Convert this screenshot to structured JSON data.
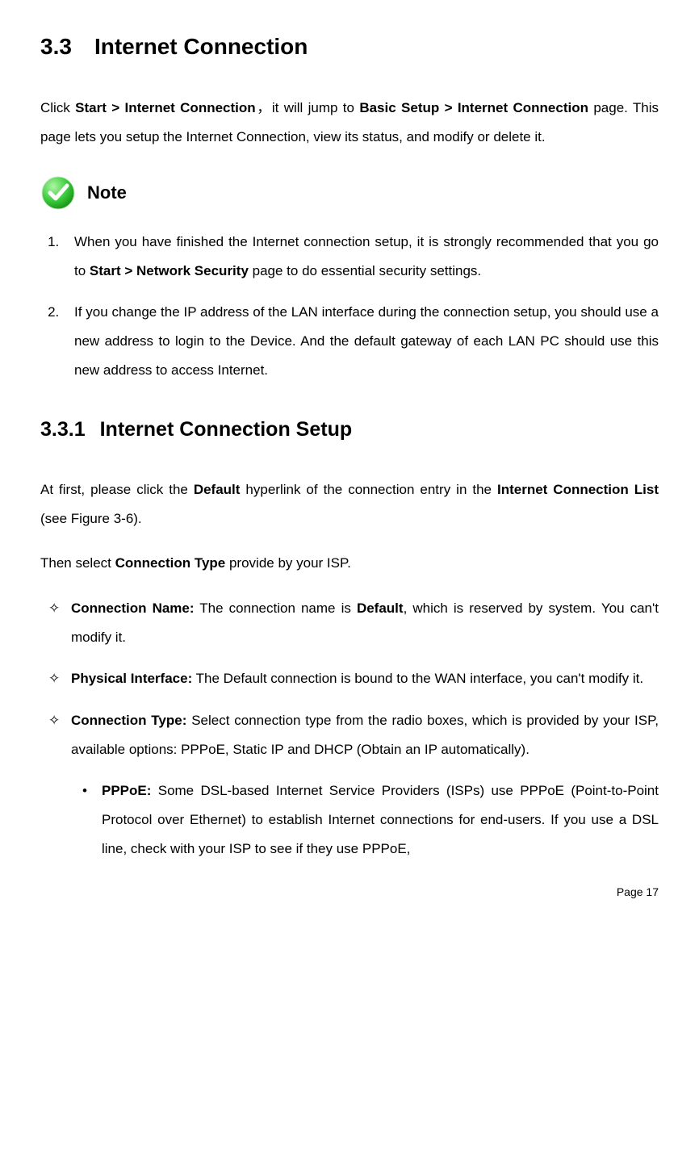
{
  "section": {
    "number": "3.3",
    "title": "Internet Connection",
    "intro_pre": "Click ",
    "intro_b1": "Start > Internet Connection",
    "intro_mid": "，it will jump to ",
    "intro_b2": "Basic Setup > Internet Connection",
    "intro_post": " page. This page lets you setup the Internet Connection, view its status, and modify or delete it."
  },
  "note": {
    "label": "Note",
    "items": [
      {
        "pre": "When you have finished the Internet connection setup, it is strongly recommended that you go to ",
        "bold": "Start > Network Security",
        "post": " page to do essential security settings."
      },
      {
        "pre": "If you change the IP address of the LAN interface during the connection setup, you should use a new address to login to the Device. And the default gateway of each LAN PC should use this new address to access Internet.",
        "bold": "",
        "post": ""
      }
    ]
  },
  "subsection": {
    "number": "3.3.1",
    "title": "Internet Connection Setup",
    "para1_pre": "At first, please click the ",
    "para1_b1": "Default",
    "para1_mid": " hyperlink of the connection entry in the ",
    "para1_b2": "Internet Connection List",
    "para1_post": " (see Figure 3-6).",
    "para2_pre": "Then select ",
    "para2_b1": "Connection Type",
    "para2_post": " provide by your ISP."
  },
  "diamond_list": [
    {
      "label": "Connection Name:",
      "text_pre": " The connection name is ",
      "text_b1": "Default",
      "text_post": ", which is reserved by system. You can't modify it."
    },
    {
      "label": "Physical Interface:",
      "text_pre": " The Default connection is bound to the WAN interface, you can't modify it.",
      "text_b1": "",
      "text_post": ""
    },
    {
      "label": "Connection Type:",
      "text_pre": " Select connection type from the radio boxes, which is provided by your ISP, available options: PPPoE, Static IP and DHCP (Obtain an IP automatically).",
      "text_b1": "",
      "text_post": ""
    }
  ],
  "bullet_list": [
    {
      "label": "PPPoE:",
      "text": " Some DSL-based Internet Service Providers (ISPs) use PPPoE (Point-to-Point Protocol over Ethernet) to establish Internet connections for end-users. If you use a DSL line, check with your ISP to see if they use PPPoE,"
    }
  ],
  "footer": {
    "page_label": "Page 17"
  }
}
